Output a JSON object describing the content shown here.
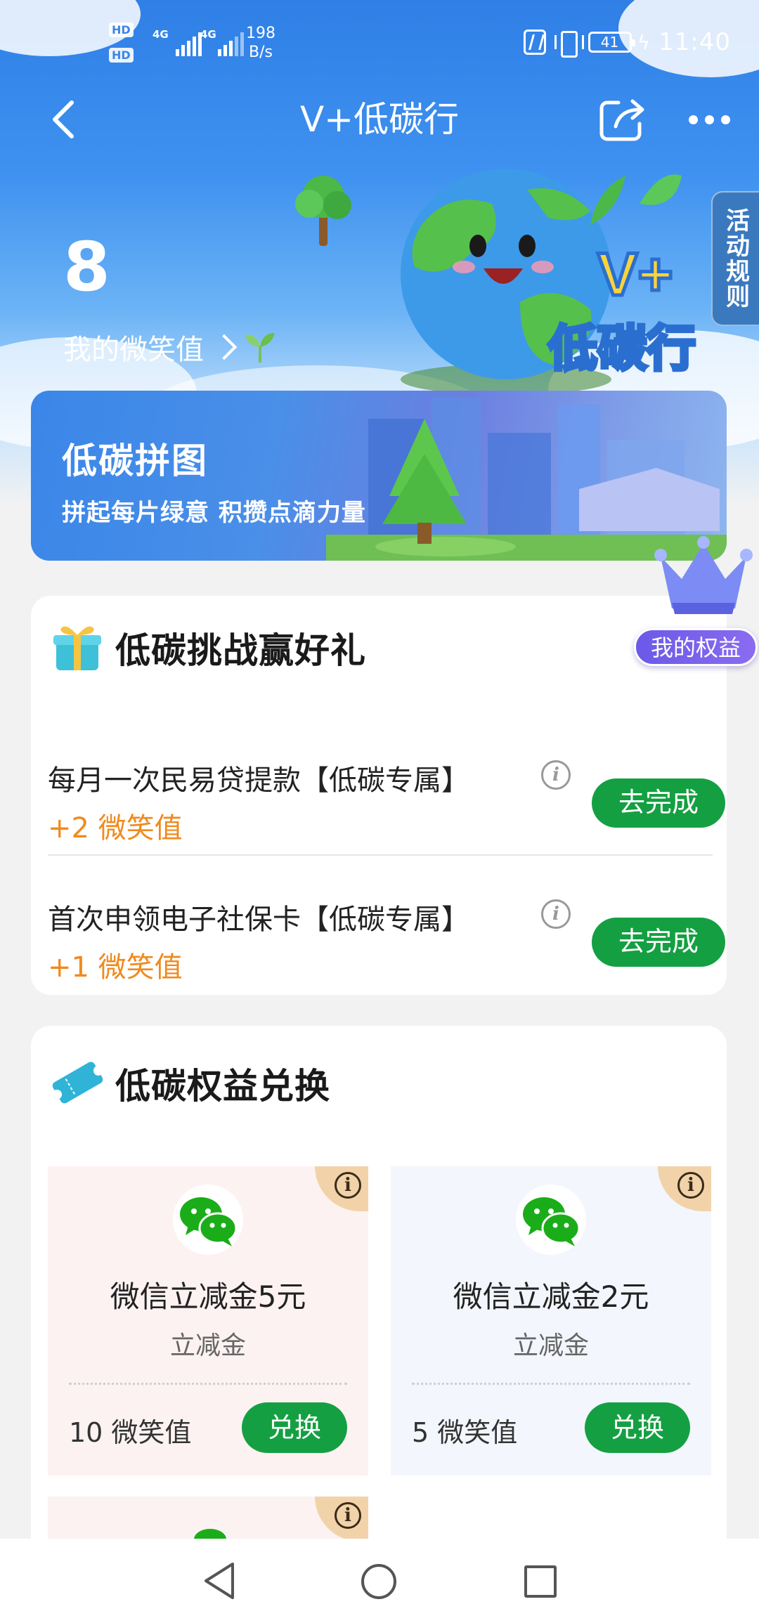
{
  "status_bar": {
    "hd_1": "HD",
    "hd_2": "HD",
    "sim1_network": "4G",
    "sim2_network": "4G",
    "net_speed_value": "198",
    "net_speed_unit": "B/s",
    "battery": "41",
    "time": "11:40"
  },
  "header": {
    "title": "V+低碳行",
    "back_icon": "back-arrow-icon",
    "share_icon": "share-icon",
    "more_icon": "more-icon"
  },
  "hero": {
    "score": "8",
    "score_label": "我的微笑值",
    "rules_tab": "活动规则",
    "globe_logo_text": "V+ 低碳行"
  },
  "puzzle_banner": {
    "title": "低碳拼图",
    "subtitle": "拼起每片绿意 积攒点滴力量"
  },
  "benefits_badge": "我的权益",
  "challenge": {
    "title": "低碳挑战赢好礼",
    "tasks": [
      {
        "name": "每月一次民易贷提款【低碳专属】",
        "reward": "+2 微笑值",
        "button": "去完成"
      },
      {
        "name": "首次申领电子社保卡【低碳专属】",
        "reward": "+1 微笑值",
        "button": "去完成"
      }
    ]
  },
  "exchange": {
    "title": "低碳权益兑换",
    "coupons": [
      {
        "name": "微信立减金5元",
        "type": "立减金",
        "cost": "10 微笑值",
        "button": "兑换",
        "bg": "#fdf2f2"
      },
      {
        "name": "微信立减金2元",
        "type": "立减金",
        "cost": "5 微笑值",
        "button": "兑换",
        "bg": "#f3f6fc"
      }
    ]
  },
  "colors": {
    "primary_green": "#14a042",
    "reward_orange": "#f08a1e",
    "hero_blue": "#3f92f0"
  }
}
